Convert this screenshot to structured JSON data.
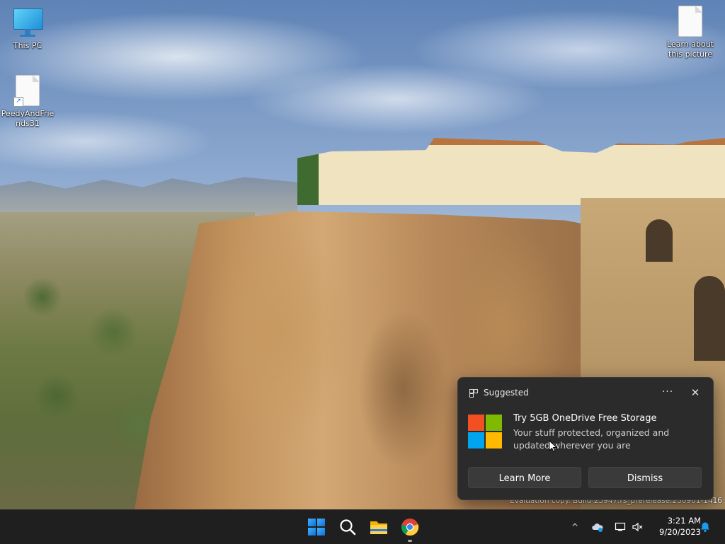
{
  "desktop": {
    "icons": [
      {
        "label": "This PC"
      },
      {
        "label": "PeedyAndFriends31"
      },
      {
        "label": "Learn about this picture"
      }
    ]
  },
  "watermark": {
    "text": "Evaluation copy. Build 25947.rs_prerelease.230901-1416"
  },
  "notification": {
    "header": "Suggested",
    "more_label": "···",
    "close_label": "✕",
    "title": "Try 5GB OneDrive Free Storage",
    "body": "Your stuff protected, organized and updated wherever you are",
    "primary_button": "Learn More",
    "secondary_button": "Dismiss"
  },
  "taskbar": {
    "apps": [
      "start-button",
      "search",
      "file-explorer",
      "chrome"
    ],
    "tray": {
      "chevron": "^",
      "icons": [
        "onedrive-icon",
        "network-icon",
        "volume-muted-icon"
      ]
    },
    "clock": {
      "time": "3:21 AM",
      "date": "9/20/2023"
    }
  },
  "colors": {
    "taskbar_bg": "#1f1f1f",
    "toast_bg": "#2b2b2b",
    "notification_accent": "#1a9bf0"
  }
}
